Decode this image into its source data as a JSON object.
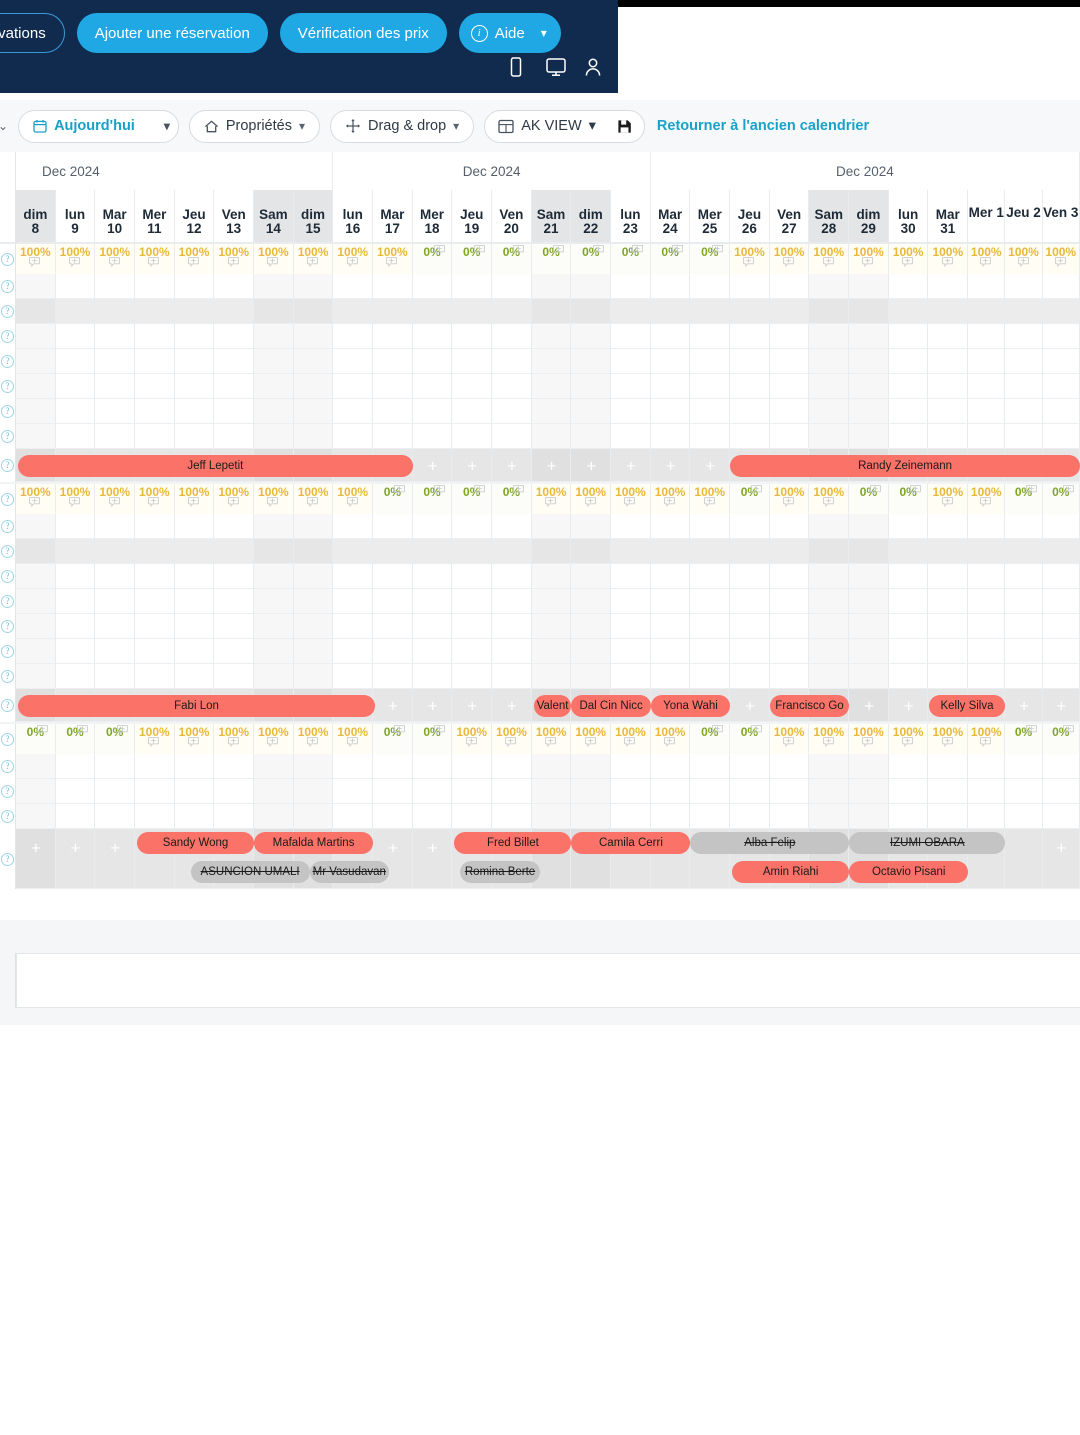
{
  "header": {
    "search_pill_label": "réservations",
    "add_booking_label": "Ajouter une réservation",
    "price_check_label": "Vérification des prix",
    "help_label": "Aide",
    "icons": [
      "mobile-icon",
      "desktop-icon",
      "user-icon"
    ]
  },
  "toolbar": {
    "left_caret": "⌄",
    "today_label": "Aujourd'hui",
    "properties_label": "Propriétés",
    "dragdrop_label": "Drag & drop",
    "view_label": "AK VIEW",
    "save_icon": "floppy-disk-icon",
    "old_calendar_link": "Retourner à l'ancien calendrier"
  },
  "calendar": {
    "month_labels": [
      "Dec 2024",
      "Dec 2024",
      "Dec 2024"
    ],
    "days": [
      {
        "dow": "dim",
        "num": "8",
        "weekend": true,
        "single": false
      },
      {
        "dow": "lun",
        "num": "9",
        "weekend": false,
        "single": false
      },
      {
        "dow": "Mar",
        "num": "10",
        "weekend": false,
        "single": false
      },
      {
        "dow": "Mer",
        "num": "11",
        "weekend": false,
        "single": false
      },
      {
        "dow": "Jeu",
        "num": "12",
        "weekend": false,
        "single": false
      },
      {
        "dow": "Ven",
        "num": "13",
        "weekend": false,
        "single": false
      },
      {
        "dow": "Sam",
        "num": "14",
        "weekend": true,
        "single": false
      },
      {
        "dow": "dim",
        "num": "15",
        "weekend": true,
        "single": false
      },
      {
        "dow": "lun",
        "num": "16",
        "weekend": false,
        "single": false
      },
      {
        "dow": "Mar",
        "num": "17",
        "weekend": false,
        "single": false
      },
      {
        "dow": "Mer",
        "num": "18",
        "weekend": false,
        "single": false
      },
      {
        "dow": "Jeu",
        "num": "19",
        "weekend": false,
        "single": false
      },
      {
        "dow": "Ven",
        "num": "20",
        "weekend": false,
        "single": false
      },
      {
        "dow": "Sam",
        "num": "21",
        "weekend": true,
        "single": false
      },
      {
        "dow": "dim",
        "num": "22",
        "weekend": true,
        "single": false
      },
      {
        "dow": "lun",
        "num": "23",
        "weekend": false,
        "single": false
      },
      {
        "dow": "Mar",
        "num": "24",
        "weekend": false,
        "single": false
      },
      {
        "dow": "Mer",
        "num": "25",
        "weekend": false,
        "single": false
      },
      {
        "dow": "Jeu",
        "num": "26",
        "weekend": false,
        "single": false
      },
      {
        "dow": "Ven",
        "num": "27",
        "weekend": false,
        "single": false
      },
      {
        "dow": "Sam",
        "num": "28",
        "weekend": true,
        "single": false
      },
      {
        "dow": "dim",
        "num": "29",
        "weekend": true,
        "single": false
      },
      {
        "dow": "lun",
        "num": "30",
        "weekend": false,
        "single": false
      },
      {
        "dow": "Mar",
        "num": "31",
        "weekend": false,
        "single": false
      },
      {
        "dow": "Mer 1",
        "num": "",
        "weekend": false,
        "single": true
      },
      {
        "dow": "Jeu 2",
        "num": "",
        "weekend": false,
        "single": true
      },
      {
        "dow": "Ven 3",
        "num": "",
        "weekend": false,
        "single": true
      }
    ],
    "month_spans": [
      {
        "label": "Dec 2024",
        "start": 0,
        "span": 8
      },
      {
        "label": "Dec 2024",
        "start": 8,
        "span": 8
      },
      {
        "label": "Dec 2024",
        "start": 16,
        "span": 11
      }
    ]
  },
  "properties": [
    {
      "name": "property-1",
      "occupancy": [
        "100%",
        "100%",
        "100%",
        "100%",
        "100%",
        "100%",
        "100%",
        "100%",
        "100%",
        "100%",
        "0%",
        "0%",
        "0%",
        "0%",
        "0%",
        "0%",
        "0%",
        "0%",
        "100%",
        "100%",
        "100%",
        "100%",
        "100%",
        "100%",
        "100%",
        "100%",
        "100%"
      ],
      "empty_rows": 7,
      "shaded_row_index": 1,
      "bookings": [
        {
          "label": "Jeff Lepetit",
          "start": 0.05,
          "end": 10.0,
          "status": "reserved",
          "lane": 0
        },
        {
          "label": "Randy Zeinemann",
          "start": 18.0,
          "end": 27.2,
          "status": "reserved",
          "lane": 0
        }
      ],
      "plus_cells": [
        10,
        11,
        12,
        13,
        14,
        15,
        16,
        17
      ]
    },
    {
      "name": "property-2",
      "occupancy": [
        "100%",
        "100%",
        "100%",
        "100%",
        "100%",
        "100%",
        "100%",
        "100%",
        "100%",
        "0%",
        "0%",
        "0%",
        "0%",
        "100%",
        "100%",
        "100%",
        "100%",
        "100%",
        "0%",
        "100%",
        "100%",
        "0%",
        "0%",
        "100%",
        "100%",
        "0%",
        "0%"
      ],
      "empty_rows": 7,
      "shaded_row_index": 1,
      "bookings": [
        {
          "label": "Fabi Lon",
          "start": 0.05,
          "end": 9.05,
          "status": "reserved",
          "lane": 0
        },
        {
          "label": "Valent",
          "start": 13.05,
          "end": 14.0,
          "status": "reserved",
          "lane": 0
        },
        {
          "label": "Dal Cin Nicc",
          "start": 14.0,
          "end": 16.0,
          "status": "reserved",
          "lane": 0
        },
        {
          "label": "Yona Wahi",
          "start": 16.0,
          "end": 18.0,
          "status": "reserved",
          "lane": 0
        },
        {
          "label": "Francisco Go",
          "start": 19.0,
          "end": 21.0,
          "status": "reserved",
          "lane": 0
        },
        {
          "label": "Kelly Silva",
          "start": 23.0,
          "end": 25.0,
          "status": "reserved",
          "lane": 0
        }
      ],
      "plus_cells": [
        9,
        10,
        11,
        12,
        18,
        21,
        22,
        25,
        26
      ]
    },
    {
      "name": "property-3",
      "occupancy": [
        "0%",
        "0%",
        "0%",
        "100%",
        "100%",
        "100%",
        "100%",
        "100%",
        "100%",
        "0%",
        "0%",
        "100%",
        "100%",
        "100%",
        "100%",
        "100%",
        "100%",
        "0%",
        "0%",
        "100%",
        "100%",
        "100%",
        "100%",
        "100%",
        "100%",
        "0%",
        "0%"
      ],
      "empty_rows": 3,
      "shaded_row_index": -1,
      "bookings": [
        {
          "label": "Sandy Wong",
          "start": 3.05,
          "end": 6.0,
          "status": "reserved",
          "lane": 0
        },
        {
          "label": "Mafalda Martins",
          "start": 6.0,
          "end": 9.0,
          "status": "reserved",
          "lane": 0
        },
        {
          "label": "Fred Billet",
          "start": 11.05,
          "end": 14.0,
          "status": "reserved",
          "lane": 0
        },
        {
          "label": "Camila Cerri",
          "start": 14.0,
          "end": 17.0,
          "status": "reserved",
          "lane": 0
        },
        {
          "label": "Alba Felip",
          "start": 17.0,
          "end": 21.0,
          "status": "cancelled",
          "lane": 0
        },
        {
          "label": "IZUMI OBARA",
          "start": 21.0,
          "end": 25.0,
          "status": "cancelled",
          "lane": 0
        },
        {
          "label": "ASUNCION UMALI",
          "start": 4.4,
          "end": 7.4,
          "status": "cancelled",
          "lane": 1
        },
        {
          "label": "Mr Vasudavan",
          "start": 7.4,
          "end": 9.4,
          "status": "cancelled",
          "lane": 1
        },
        {
          "label": "Romina Berte",
          "start": 11.2,
          "end": 13.2,
          "status": "cancelled",
          "lane": 1
        },
        {
          "label": "Amin Riahi",
          "start": 18.05,
          "end": 21.0,
          "status": "reserved",
          "lane": 1
        },
        {
          "label": "Octavio Pisani",
          "start": 21.0,
          "end": 24.0,
          "status": "reserved",
          "lane": 1
        }
      ],
      "plus_cells": [
        0,
        1,
        2,
        9,
        10,
        26
      ]
    }
  ]
}
